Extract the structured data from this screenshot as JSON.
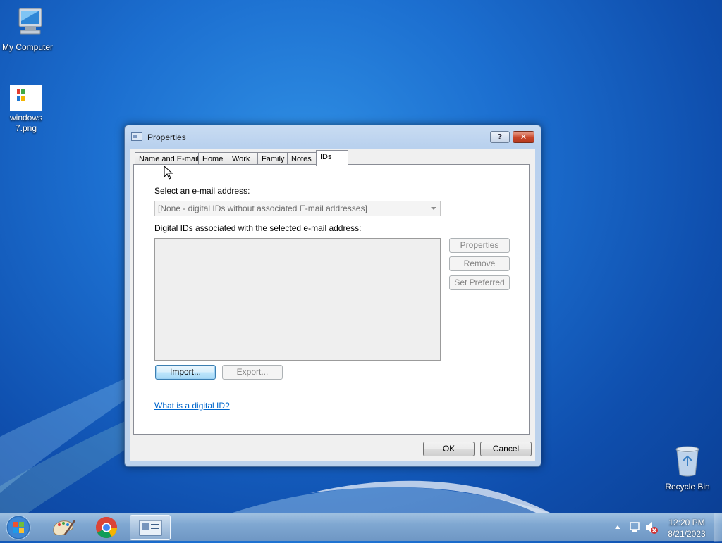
{
  "desktop": {
    "icons": [
      {
        "label": "My Computer"
      },
      {
        "label": "windows 7.png"
      },
      {
        "label": "Recycle Bin"
      }
    ]
  },
  "dialog": {
    "title": "Properties",
    "help_label": "?",
    "tabs": [
      {
        "label": "Name and E-mail"
      },
      {
        "label": "Home"
      },
      {
        "label": "Work"
      },
      {
        "label": "Family"
      },
      {
        "label": "Notes"
      },
      {
        "label": "IDs"
      }
    ],
    "active_tab": "IDs",
    "select_email_label": "Select an e-mail address:",
    "email_combo_value": "[None - digital IDs without associated E-mail addresses]",
    "digital_ids_label": "Digital IDs associated with the selected e-mail address:",
    "buttons": {
      "properties": "Properties",
      "remove": "Remove",
      "set_preferred": "Set Preferred",
      "import": "Import...",
      "export": "Export...",
      "ok": "OK",
      "cancel": "Cancel"
    },
    "help_link": "What is a digital ID?"
  },
  "taskbar": {
    "clock_time": "12:20 PM",
    "clock_date": "8/21/2023"
  },
  "colors": {
    "accent": "#1c6fd0",
    "link": "#0066cc",
    "close": "#c8472b"
  }
}
